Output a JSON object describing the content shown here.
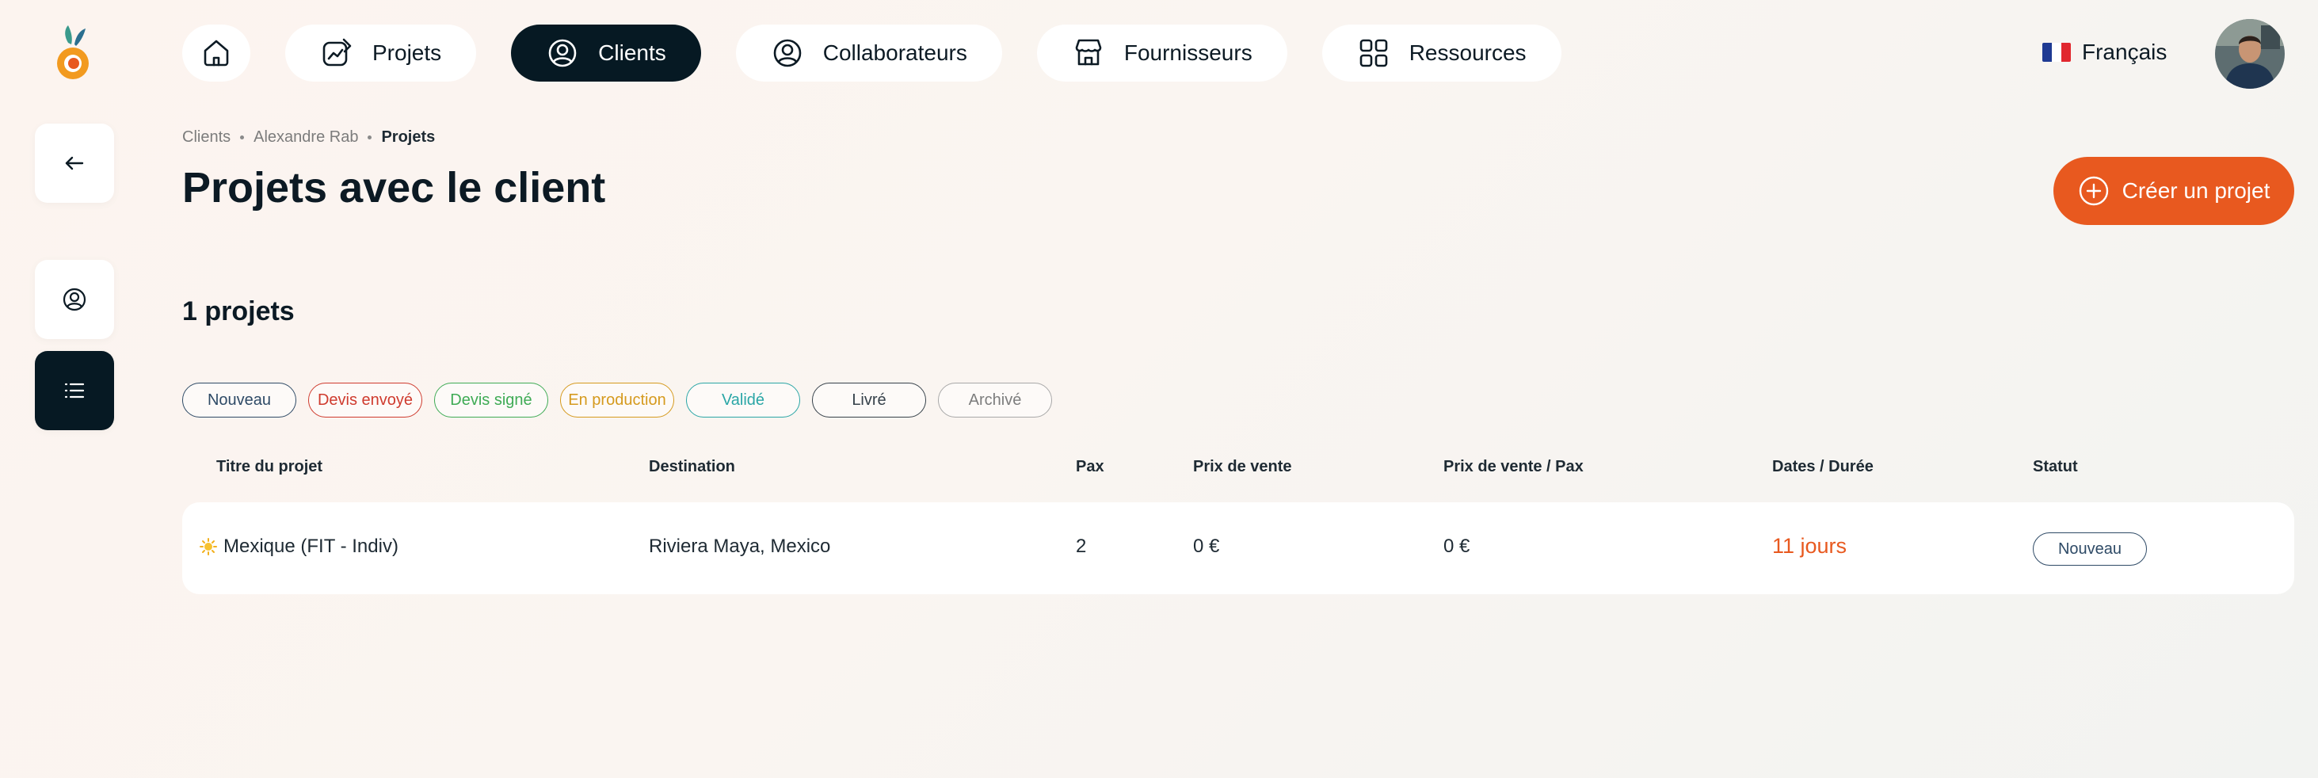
{
  "nav": {
    "home_icon": "home-icon",
    "items": [
      {
        "label": "Projets",
        "icon": "projects-icon"
      },
      {
        "label": "Clients",
        "icon": "client-icon",
        "active": true
      },
      {
        "label": "Collaborateurs",
        "icon": "user-icon"
      },
      {
        "label": "Fournisseurs",
        "icon": "store-icon"
      },
      {
        "label": "Ressources",
        "icon": "grid-icon"
      }
    ]
  },
  "language": {
    "label": "Français",
    "flag_colors": [
      "#1f3a93",
      "#ffffff",
      "#e1272e"
    ]
  },
  "breadcrumb": [
    "Clients",
    "Alexandre Rab",
    "Projets"
  ],
  "page_title": "Projets avec le client",
  "create_button": {
    "label": "Créer un projet",
    "color": "#e8591f"
  },
  "count_label": "1 projets",
  "filters": [
    {
      "label": "Nouveau",
      "color": "#2e4a66"
    },
    {
      "label": "Devis envoyé",
      "color": "#cf3b2e"
    },
    {
      "label": "Devis signé",
      "color": "#3fab55"
    },
    {
      "label": "En production",
      "color": "#d59a1e"
    },
    {
      "label": "Validé",
      "color": "#2aa6a6"
    },
    {
      "label": "Livré",
      "color": "#36414a"
    },
    {
      "label": "Archivé",
      "color": "#8a8a8a"
    }
  ],
  "table": {
    "headers": [
      "Titre du projet",
      "Destination",
      "Pax",
      "Prix de vente",
      "Prix de vente / Pax",
      "Dates / Durée",
      "Statut"
    ],
    "rows": [
      {
        "icon": "sun-icon",
        "title": "Mexique (FIT - Indiv)",
        "destination": "Riviera Maya, Mexico",
        "pax": "2",
        "price": "0 €",
        "price_per_pax": "0 €",
        "duration": "11 jours",
        "status": "Nouveau"
      }
    ]
  }
}
